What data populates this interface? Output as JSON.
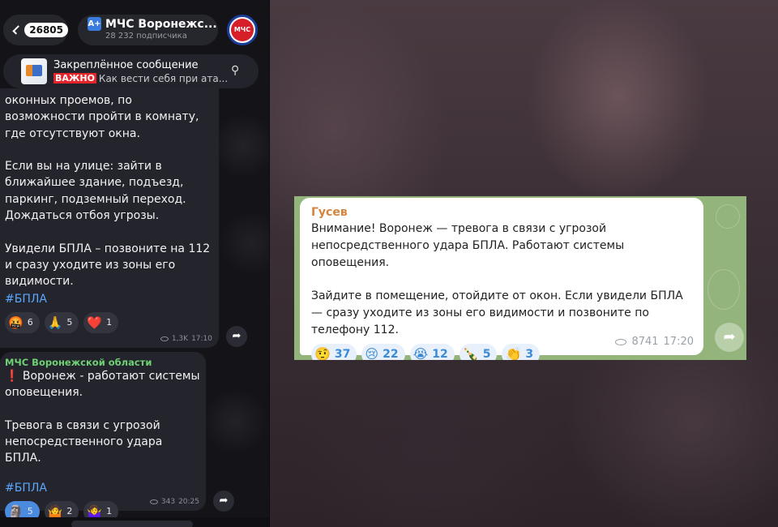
{
  "header": {
    "unread_count": "26805",
    "channel_title": "МЧС Воронежс...",
    "subscribers": "28 232 подписчика",
    "avatar_text": "МЧС"
  },
  "pinned": {
    "title": "Закреплённое сообщение",
    "badge": "ВАЖНО",
    "preview": "Как вести себя при ата..."
  },
  "message1": {
    "text": "оконных проемов, по возможности пройти в комнату, где отсутствуют окна.\n\nЕсли вы на улице: зайти в ближайшее здание, подъезд, паркинг, подземный переход. Дождаться отбоя угрозы.\n\nУвидели БПЛА – позвоните на 112 и сразу уходите из зоны его видимости.",
    "hashtag": "#БПЛА",
    "reactions": [
      {
        "emoji": "🤬",
        "count": "6"
      },
      {
        "emoji": "🙏",
        "count": "5"
      },
      {
        "emoji": "❤️",
        "count": "1"
      }
    ],
    "views": "1,3K",
    "time": "17:10"
  },
  "message2": {
    "sender": "МЧС Воронежской области",
    "text": "❗ Воронеж - работают системы оповещения.\n\nТревога в связи с угрозой непосредственного удара БПЛА.",
    "hashtag": "#БПЛА",
    "reactions": [
      {
        "emoji": "🗿",
        "count": "5"
      },
      {
        "emoji": "🤷",
        "count": "2"
      },
      {
        "emoji": "🤷‍♀️",
        "count": "1"
      }
    ],
    "views": "343",
    "time": "20:25"
  },
  "telegram_card": {
    "sender": "Гусев",
    "text": "Внимание! Воронеж — тревога в связи с угрозой непосредственного удара БПЛА. Работают системы оповещения.\n\nЗайдите в помещение, отойдите от окон. Если увидели БПЛА — сразу уходите из зоны его видимости и позвоните по телефону 112.",
    "reactions": [
      {
        "emoji": "🤨",
        "count": "37"
      },
      {
        "emoji": "😢",
        "count": "22"
      },
      {
        "emoji": "😭",
        "count": "12"
      },
      {
        "emoji": "🍾",
        "count": "5"
      },
      {
        "emoji": "👏",
        "count": "3"
      }
    ],
    "views": "8741",
    "time": "17:20"
  },
  "colors": {
    "hashtag": "#5aa8ff",
    "sender_green": "#6ed174",
    "sender_orange": "#d5843b",
    "card_bg": "#93b57c"
  }
}
